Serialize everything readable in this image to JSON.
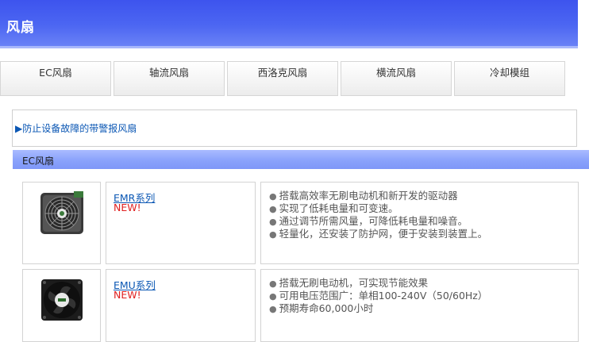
{
  "header": {
    "title": "风扇"
  },
  "tabs": [
    {
      "label": "EC风扇"
    },
    {
      "label": "轴流风扇"
    },
    {
      "label": "西洛克风扇"
    },
    {
      "label": "横流风扇"
    },
    {
      "label": "冷却模组"
    }
  ],
  "alarm_link": {
    "label": "▶防止设备故障的带警报风扇"
  },
  "section": {
    "title": "EC风扇"
  },
  "products": [
    {
      "name": "EMR系列",
      "badge": "NEW!",
      "image_icon": "fan-with-grille-icon",
      "features": [
        "搭载高效率无刷电动机和新开发的驱动器",
        "实现了低耗电量和可变速。",
        "通过调节所需风量，可降低耗电量和噪音。",
        "轻量化，还安装了防护网，便于安装到装置上。"
      ]
    },
    {
      "name": "EMU系列",
      "badge": "NEW!",
      "image_icon": "axial-fan-icon",
      "features": [
        "搭载无刷电动机，可实现节能效果",
        "可用电压范围广：单相100-240V（50/60Hz）",
        "预期寿命60,000小时"
      ]
    }
  ],
  "colors": {
    "banner": "#4c66f2",
    "section_header": "#8aa2fb",
    "link": "#0b57b4",
    "new_badge": "#e02020"
  }
}
